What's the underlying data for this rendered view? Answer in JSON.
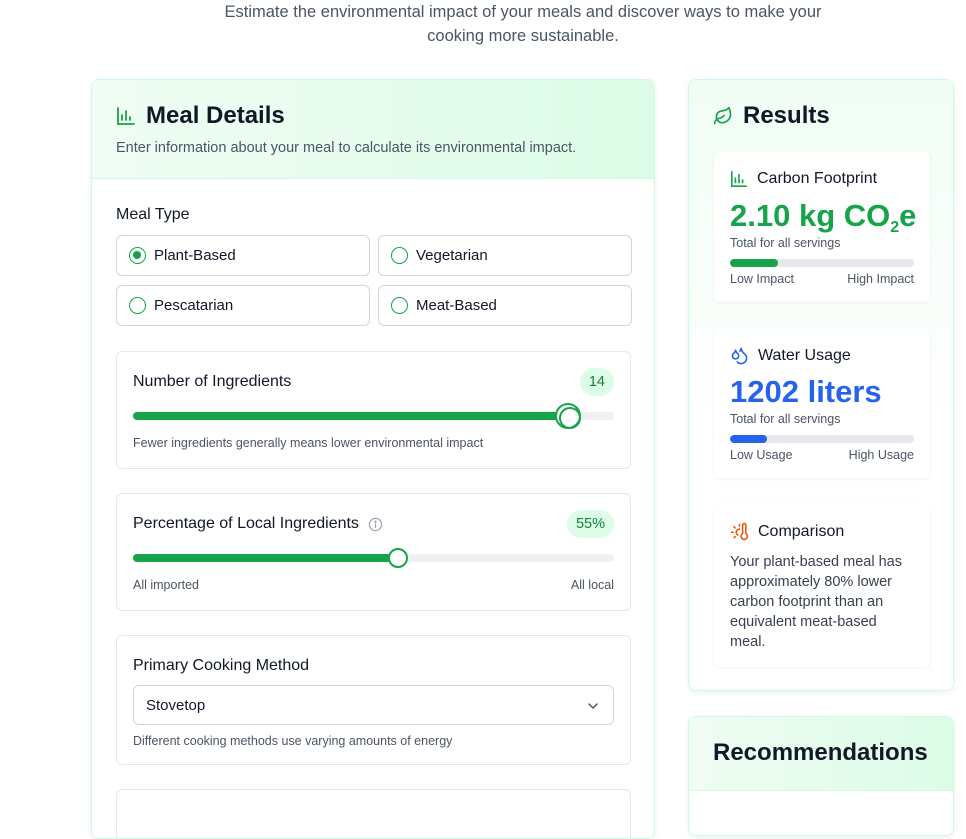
{
  "intro": {
    "line1": "Estimate the environmental impact of your meals and discover ways to make your",
    "line2": "cooking more sustainable."
  },
  "meal": {
    "title": "Meal Details",
    "subtitle": "Enter information about your meal to calculate its environmental impact.",
    "meal_type_label": "Meal Type",
    "meal_types": [
      "Plant-Based",
      "Vegetarian",
      "Pescatarian",
      "Meat-Based"
    ],
    "selected_meal_type": "Plant-Based",
    "ingredients": {
      "label": "Number of Ingredients",
      "value": "14",
      "level": 0.905,
      "hint": "Fewer ingredients generally means lower environmental impact"
    },
    "local": {
      "label": "Percentage of Local Ingredients",
      "value": "55%",
      "level": 0.55,
      "min_label": "All imported",
      "max_label": "All local"
    },
    "cooking": {
      "label": "Primary Cooking Method",
      "selected": "Stovetop",
      "hint": "Different cooking methods use varying amounts of energy"
    }
  },
  "results": {
    "title": "Results",
    "carbon": {
      "label": "Carbon Footprint",
      "value_prefix": "2.10 kg CO",
      "value_sub": "2",
      "value_suffix": "e",
      "caption": "Total for all servings",
      "level": 0.26,
      "low": "Low Impact",
      "high": "High Impact",
      "color": "#16a34a"
    },
    "water": {
      "label": "Water Usage",
      "value": "1202 liters",
      "caption": "Total for all servings",
      "level": 0.2,
      "low": "Low Usage",
      "high": "High Usage",
      "color": "#2563eb"
    },
    "comparison": {
      "label": "Comparison",
      "text": "Your plant-based meal has approximately 80% lower carbon footprint than an equivalent meat-based meal."
    }
  },
  "recommendations": {
    "title": "Recommendations"
  },
  "icons": {
    "meal_title": "bar-chart-icon",
    "results_title": "leaf-icon",
    "carbon": "bar-chart-icon",
    "water": "droplets-icon",
    "comparison": "thermometer-sun-icon",
    "info": "info-icon",
    "select": "chevron-down-icon"
  }
}
